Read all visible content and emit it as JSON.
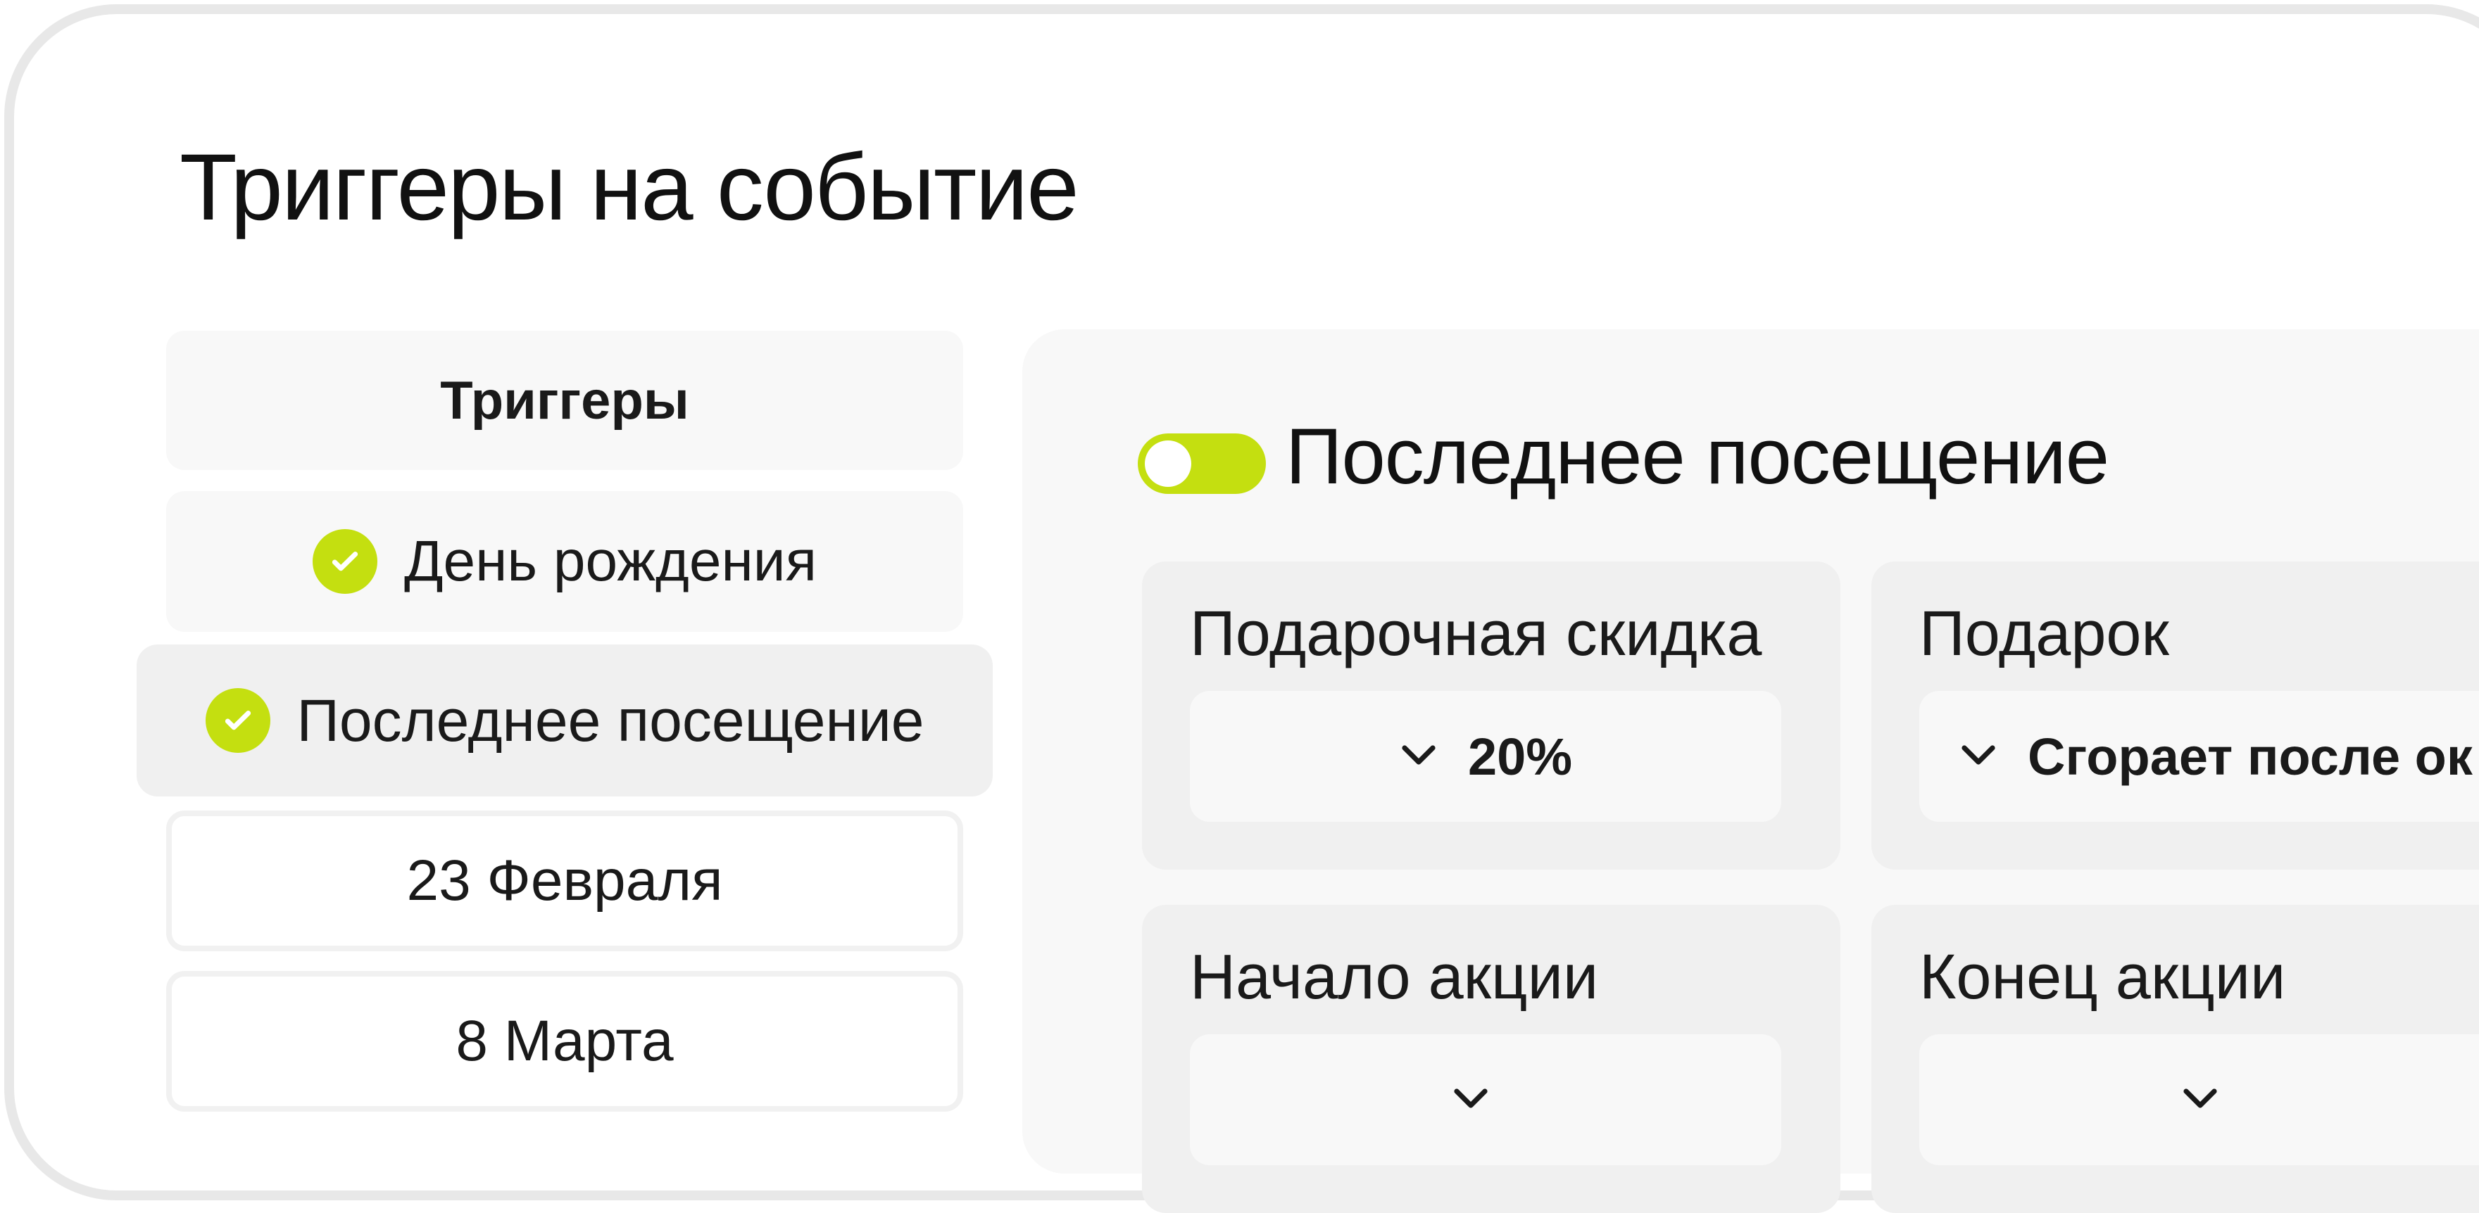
{
  "page": {
    "title": "Триггеры на событие"
  },
  "menu": {
    "header": "Триггеры",
    "items": [
      {
        "label": "День рождения",
        "checked": true
      },
      {
        "label": "Последнее посещение",
        "checked": true,
        "active": true
      },
      {
        "label": "23 Февраля",
        "checked": false
      },
      {
        "label": "8 Марта",
        "checked": false
      }
    ]
  },
  "panel": {
    "title": "Последнее посещение",
    "toggle": "on",
    "cards": [
      {
        "label": "Подарочная скидка",
        "value": "20%"
      },
      {
        "label": "Подарок",
        "value": "Сгорает после ок"
      },
      {
        "label": "Начало акции",
        "value": ""
      },
      {
        "label": "Конец акции",
        "value": ""
      }
    ]
  },
  "colors": {
    "accent": "#c4df10",
    "panel_bg": "#f8f8f8",
    "card_bg": "#f0f0f0",
    "frame_border": "#e8e8e8"
  },
  "icons": {
    "check": "check-circle-icon",
    "dropdown": "chevron-down-icon"
  }
}
